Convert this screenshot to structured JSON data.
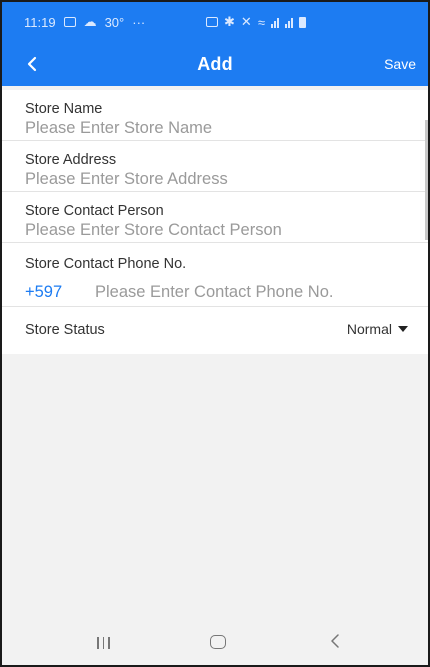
{
  "status_bar": {
    "time": "11:19",
    "temperature": "30°",
    "more": "···"
  },
  "app_bar": {
    "back_icon": "chevron-left-icon",
    "title": "Add",
    "save_label": "Save"
  },
  "form": {
    "store_name": {
      "label": "Store Name",
      "placeholder": "Please Enter Store Name",
      "value": ""
    },
    "store_address": {
      "label": "Store Address",
      "placeholder": "Please Enter Store Address",
      "value": ""
    },
    "contact_person": {
      "label": "Store Contact Person",
      "placeholder": "Please Enter Store Contact Person",
      "value": ""
    },
    "contact_phone": {
      "label": "Store Contact Phone No.",
      "country_code": "+597",
      "placeholder": "Please Enter Contact Phone No.",
      "value": ""
    },
    "store_status": {
      "label": "Store Status",
      "selected": "Normal"
    }
  },
  "nav_bar": {
    "recent_icon": "recent-apps-icon",
    "home_icon": "home-icon",
    "back_icon": "back-icon"
  },
  "colors": {
    "accent": "#1d7cf2",
    "background": "#f2f2f2",
    "placeholder": "#9a9a9a"
  }
}
